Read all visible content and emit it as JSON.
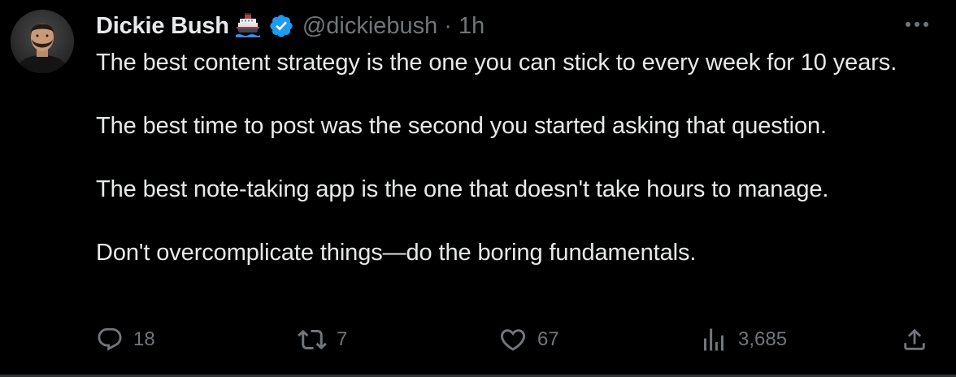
{
  "author": {
    "name": "Dickie Bush",
    "handle": "@dickiebush",
    "separator": "·",
    "time": "1h",
    "emoji_icon": "ship-icon",
    "verified_icon": "verified-badge-icon",
    "verified_color": "#1d9bf0"
  },
  "tweet": {
    "paragraphs": [
      "The best content strategy is the one you can stick to every week for 10 years.",
      "The best time to post was the second you started asking that question.",
      "The best note-taking app is the one that doesn't take hours to manage.",
      "Don't overcomplicate things—do the boring fundamentals."
    ]
  },
  "actions": {
    "reply": {
      "icon": "reply-icon",
      "count": "18"
    },
    "retweet": {
      "icon": "retweet-icon",
      "count": "7"
    },
    "like": {
      "icon": "heart-icon",
      "count": "67"
    },
    "views": {
      "icon": "views-chart-icon",
      "count": "3,685"
    },
    "share": {
      "icon": "share-icon"
    }
  },
  "menu": {
    "icon": "more-options-icon"
  },
  "colors": {
    "background": "#000000",
    "text": "#e7e9ea",
    "secondary": "#71767b"
  }
}
